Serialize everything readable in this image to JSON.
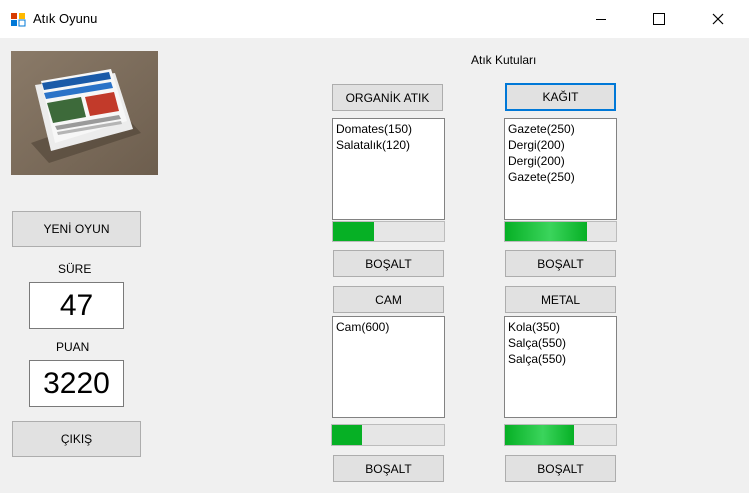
{
  "window": {
    "title": "Atık Oyunu"
  },
  "image_alt": "newspapers",
  "left_panel": {
    "new_game_label": "YENİ OYUN",
    "time_label": "SÜRE",
    "time_value": "47",
    "score_label": "PUAN",
    "score_value": "3220",
    "exit_label": "ÇIKIŞ"
  },
  "bins_title": "Atık Kutuları",
  "bins": {
    "organic": {
      "label": "ORGANİK ATIK",
      "items": [
        "Domates(150)",
        "Salatalık(120)"
      ],
      "progress": 0.37,
      "empty_label": "BOŞALT"
    },
    "paper": {
      "label": "KAĞIT",
      "items": [
        "Gazete(250)",
        "Dergi(200)",
        "Dergi(200)",
        "Gazete(250)"
      ],
      "progress": 0.74,
      "empty_label": "BOŞALT"
    },
    "glass": {
      "label": "CAM",
      "items": [
        "Cam(600)"
      ],
      "progress": 0.27,
      "empty_label": "BOŞALT"
    },
    "metal": {
      "label": "METAL",
      "items": [
        "Kola(350)",
        "Salça(550)",
        "Salça(550)"
      ],
      "progress": 0.62,
      "empty_label": "BOŞALT"
    }
  },
  "colors": {
    "progress_fill": "#06b025",
    "focus_border": "#0078d7"
  }
}
